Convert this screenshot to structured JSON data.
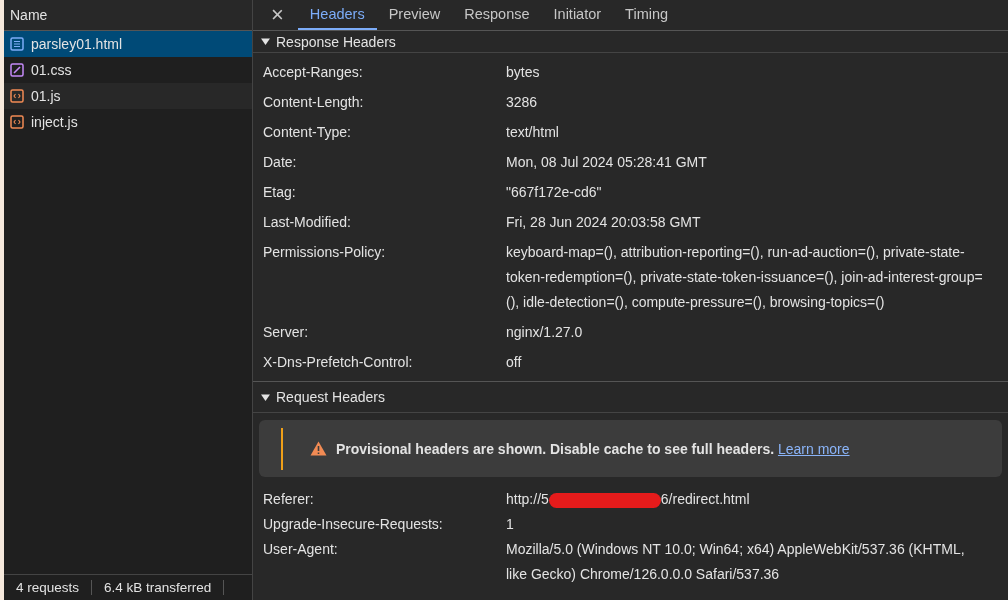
{
  "request_list": {
    "column": "Name",
    "items": [
      {
        "name": "parsley01.html",
        "kind": "document",
        "selected": true
      },
      {
        "name": "01.css",
        "kind": "stylesheet",
        "selected": false
      },
      {
        "name": "01.js",
        "kind": "script",
        "selected": false
      },
      {
        "name": "inject.js",
        "kind": "script",
        "selected": false
      }
    ],
    "status_bar": [
      "4 requests",
      "6.4 kB transferred"
    ]
  },
  "details": {
    "close": "×",
    "tabs": [
      {
        "label": "Headers",
        "selected": true
      },
      {
        "label": "Preview",
        "selected": false
      },
      {
        "label": "Response",
        "selected": false
      },
      {
        "label": "Initiator",
        "selected": false
      },
      {
        "label": "Timing",
        "selected": false
      }
    ],
    "response_headers": {
      "title": "Response Headers",
      "expanded": true,
      "rows": [
        {
          "name": "Accept-Ranges:",
          "value": "bytes"
        },
        {
          "name": "Content-Length:",
          "value": "3286"
        },
        {
          "name": "Content-Type:",
          "value": "text/html"
        },
        {
          "name": "Date:",
          "value": "Mon, 08 Jul 2024 05:28:41 GMT"
        },
        {
          "name": "Etag:",
          "value": "\"667f172e-cd6\""
        },
        {
          "name": "Last-Modified:",
          "value": "Fri, 28 Jun 2024 20:03:58 GMT"
        },
        {
          "name": "Permissions-Policy:",
          "value": "keyboard-map=(), attribution-reporting=(), run-ad-auction=(), private-state-token-redemption=(), private-state-token-issuance=(), join-ad-interest-group=(), idle-detection=(), compute-pressure=(), browsing-topics=()"
        },
        {
          "name": "Server:",
          "value": "nginx/1.27.0"
        },
        {
          "name": "X-Dns-Prefetch-Control:",
          "value": "off"
        }
      ]
    },
    "request_headers": {
      "title": "Request Headers",
      "expanded": true,
      "warning": {
        "message": "Provisional headers are shown. Disable cache to see full headers.",
        "link": "Learn more"
      },
      "rows": [
        {
          "name": "Referer:",
          "value": "http://5",
          "redacted": true,
          "value_after": "6/redirect.html"
        },
        {
          "name": "Upgrade-Insecure-Requests:",
          "value": "1",
          "redacted": false
        },
        {
          "name": "User-Agent:",
          "value": "Mozilla/5.0 (Windows NT 10.0; Win64; x64) AppleWebKit/537.36 (KHTML, like Gecko) Chrome/126.0.0.0 Safari/537.36",
          "redacted": false
        }
      ]
    }
  }
}
